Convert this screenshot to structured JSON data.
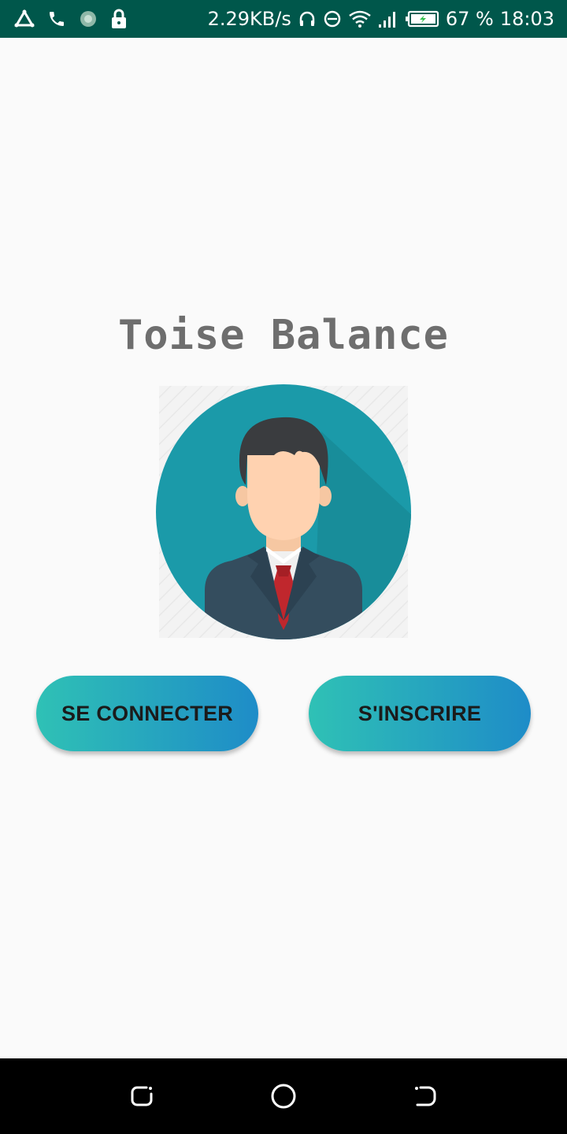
{
  "status_bar": {
    "net_speed": "2.29KB/s",
    "battery": "67 %",
    "time": "18:03",
    "background": "#00574b",
    "icons": [
      "triangle-app-icon",
      "phone-icon",
      "dots-app-icon",
      "lock-icon",
      "headphones-icon",
      "dnd-icon",
      "wifi-icon",
      "signal-icon",
      "battery-charging-icon"
    ]
  },
  "app": {
    "title": "Toise Balance",
    "avatar_icon": "businessman-avatar-icon"
  },
  "buttons": {
    "login_label": "SE CONNECTER",
    "signup_label": "S'INSCRIRE",
    "gradient_start": "#2fc1b5",
    "gradient_end": "#1e8cc8"
  },
  "nav_bar": {
    "icons": [
      "recents-icon",
      "home-icon",
      "back-icon"
    ]
  }
}
